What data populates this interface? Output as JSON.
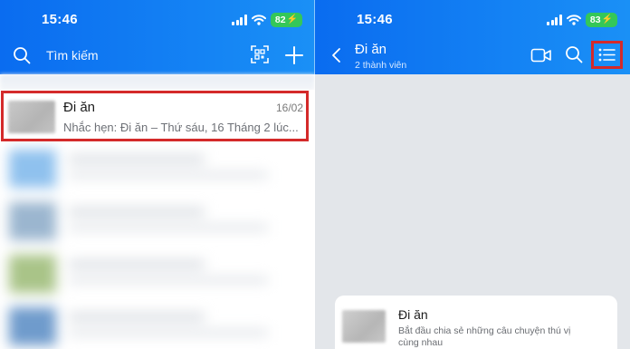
{
  "left_screen": {
    "status_bar": {
      "time": "15:46",
      "battery": "82"
    },
    "header": {
      "search_placeholder": "Tìm kiếm"
    },
    "chat_item": {
      "name": "Đi ăn",
      "date": "16/02",
      "preview": "Nhắc hẹn: Đi ăn – Thứ sáu, 16 Tháng 2 lúc..."
    },
    "blurred_rows": [
      {
        "avatar_color": "#8fc1ee"
      },
      {
        "avatar_color": "#9bb6cf"
      },
      {
        "avatar_color": "#a9c488"
      },
      {
        "avatar_color": "#6f9bcc"
      }
    ]
  },
  "right_screen": {
    "status_bar": {
      "time": "15:46",
      "battery": "83"
    },
    "header": {
      "title": "Đi ăn",
      "subtitle": "2 thành viên"
    },
    "intro_card": {
      "title": "Đi ăn",
      "text": "Bắt đầu chia sẻ những câu chuyện thú vị cùng nhau"
    }
  },
  "colors": {
    "header_blue": "#0a6cf0",
    "highlight_red": "#d42a2a",
    "battery_green": "#34c759"
  }
}
